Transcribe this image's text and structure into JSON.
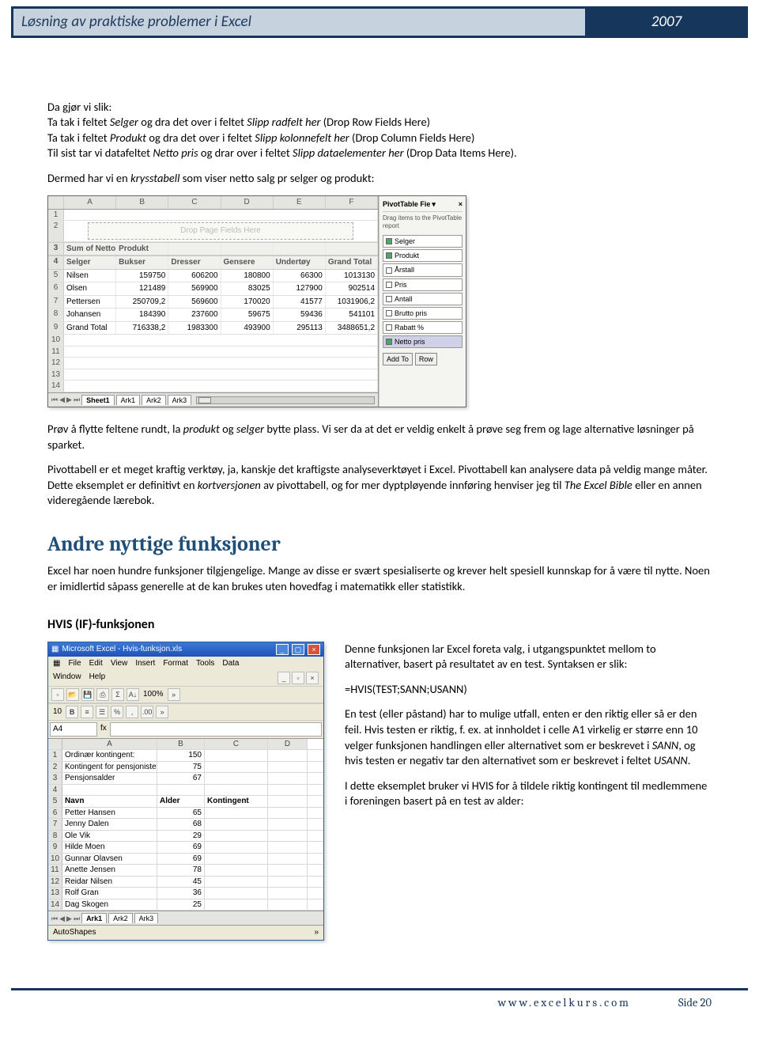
{
  "header": {
    "title": "Løsning av praktiske problemer i Excel",
    "year": "2007"
  },
  "intro": {
    "line1_a": "Da gjør vi slik:",
    "line2_a": "Ta tak i feltet ",
    "line2_b": "Selger",
    "line2_c": " og dra det over i feltet ",
    "line2_d": "Slipp radfelt her",
    "line2_e": " (Drop Row Fields Here)",
    "line3_a": "Ta tak i feltet ",
    "line3_b": "Produkt",
    "line3_c": " og dra det over i feltet ",
    "line3_d": "Slipp kolonnefelt her",
    "line3_e": " (Drop Column Fields Here)",
    "line4_a": "Til sist tar vi datafeltet ",
    "line4_b": "Netto pris",
    "line4_c": " og drar over i feltet ",
    "line4_d": "Slipp dataelementer her",
    "line4_e": " (Drop Data Items Here).",
    "lead2_a": "Dermed har vi en ",
    "lead2_b": "krysstabell",
    "lead2_c": " som viser netto salg pr selger og produkt:"
  },
  "pivot": {
    "cols": [
      "A",
      "B",
      "C",
      "D",
      "E",
      "F"
    ],
    "drop_hint": "Drop Page Fields Here",
    "corner_label": "Sum of Netto pris",
    "col_field": "Produkt",
    "row_field": "Selger",
    "headers": [
      "Bukser",
      "Dresser",
      "Gensere",
      "Undertøy",
      "Grand Total"
    ],
    "rows": [
      {
        "name": "Nilsen",
        "v": [
          "159750",
          "606200",
          "180800",
          "66300",
          "1013130"
        ]
      },
      {
        "name": "Olsen",
        "v": [
          "121489",
          "569900",
          "83025",
          "127900",
          "902514"
        ]
      },
      {
        "name": "Pettersen",
        "v": [
          "250709,2",
          "569600",
          "170020",
          "41577",
          "1031906,2"
        ]
      },
      {
        "name": "Johansen",
        "v": [
          "184390",
          "237600",
          "59675",
          "59436",
          "541101"
        ]
      },
      {
        "name": "Grand Total",
        "v": [
          "716338,2",
          "1983300",
          "493900",
          "295113",
          "3488651,2"
        ]
      }
    ],
    "tabs": [
      "Sheet1",
      "Ark1",
      "Ark2",
      "Ark3"
    ],
    "panel_title": "PivotTable Fie",
    "panel_hint": "Drag items to the PivotTable report",
    "fields": [
      {
        "label": "Selger",
        "checked": true
      },
      {
        "label": "Produkt",
        "checked": true
      },
      {
        "label": "Årstall",
        "checked": false
      },
      {
        "label": "Pris",
        "checked": false
      },
      {
        "label": "Antall",
        "checked": false
      },
      {
        "label": "Brutto pris",
        "checked": false
      },
      {
        "label": "Rabatt %",
        "checked": false
      },
      {
        "label": "Netto pris",
        "checked": true,
        "sel": true
      }
    ],
    "btn_add": "Add To",
    "btn_row": "Row"
  },
  "body": {
    "p1_a": "Prøv å flytte feltene  rundt, la ",
    "p1_b": "produkt",
    "p1_c": " og ",
    "p1_d": "selger",
    "p1_e": " bytte plass. Vi ser da at det er veldig enkelt å prøve seg frem og lage alternative løsninger på sparket.",
    "p2_a": "Pivottabell er et meget kraftig verktøy, ja, kanskje det kraftigste analyseverktøyet i Excel. Pivottabell kan analysere data på veldig mange måter. Dette eksemplet er definitivt en ",
    "p2_b": "kortversjonen",
    "p2_c": " av pivottabell, og for mer dyptpløyende innføring henviser jeg til ",
    "p2_d": "The Excel Bible",
    "p2_e": " eller en annen videregående lærebok."
  },
  "section2": {
    "heading": "Andre nyttige funksjoner",
    "para": "Excel har noen hundre funksjoner tilgjengelige. Mange av disse er svært spesialiserte og krever helt spesiell kunnskap for å være til nytte. Noen er imidlertid såpass generelle at de kan brukes uten hovedfag i matematikk eller statistikk."
  },
  "hvis": {
    "heading": "HVIS (IF)-funksjonen",
    "r1": "Denne funksjonen lar Excel foreta valg, i utgangspunktet mellom to alternativer, basert på resultatet av en test. Syntaksen er slik:",
    "formula": "=HVIS(TEST;SANN;USANN)",
    "r2_a": "En test (eller påstand) har to mulige utfall, enten er den riktig eller så er den feil. Hvis testen er riktig, f. ex. at innholdet i celle A1 virkelig er større enn 10 velger funksjonen handlingen eller alternativet som er beskrevet i ",
    "r2_b": "SANN",
    "r2_c": ", og hvis testen er negativ tar den alternativet som er beskrevet i feltet ",
    "r2_d": "USANN",
    "r2_e": ".",
    "r3": "I dette eksemplet bruker vi HVIS for å tildele riktig kontingent til medlemmene i foreningen basert på en test av alder:"
  },
  "excel2": {
    "title": "Microsoft Excel - Hvis-funksjon.xls",
    "menus": [
      "File",
      "Edit",
      "View",
      "Insert",
      "Format",
      "Tools",
      "Data",
      "Window",
      "Help"
    ],
    "zoom": "100%",
    "fontsize": "10",
    "namebox": "A4",
    "fx_label": "fx",
    "cols": [
      "A",
      "B",
      "C",
      "D"
    ],
    "data_top": [
      {
        "n": "1",
        "a": "Ordinær kontingent:",
        "b": "150",
        "c": "",
        "d": ""
      },
      {
        "n": "2",
        "a": "Kontingent for pensjonister:",
        "b": "75",
        "c": "",
        "d": ""
      },
      {
        "n": "3",
        "a": "Pensjonsalder",
        "b": "67",
        "c": "",
        "d": ""
      },
      {
        "n": "4",
        "a": "",
        "b": "",
        "c": "",
        "d": ""
      }
    ],
    "data_header": {
      "n": "5",
      "a": "Navn",
      "b": "Alder",
      "c": "Kontingent",
      "d": ""
    },
    "data_rows": [
      {
        "n": "6",
        "a": "Petter Hansen",
        "b": "65",
        "c": "",
        "d": ""
      },
      {
        "n": "7",
        "a": "Jenny Dalen",
        "b": "68",
        "c": "",
        "d": ""
      },
      {
        "n": "8",
        "a": "Ole Vik",
        "b": "29",
        "c": "",
        "d": ""
      },
      {
        "n": "9",
        "a": "Hilde Moen",
        "b": "69",
        "c": "",
        "d": ""
      },
      {
        "n": "10",
        "a": "Gunnar Olavsen",
        "b": "69",
        "c": "",
        "d": ""
      },
      {
        "n": "11",
        "a": "Anette Jensen",
        "b": "78",
        "c": "",
        "d": ""
      },
      {
        "n": "12",
        "a": "Reidar Nilsen",
        "b": "45",
        "c": "",
        "d": ""
      },
      {
        "n": "13",
        "a": "Rolf Gran",
        "b": "36",
        "c": "",
        "d": ""
      },
      {
        "n": "14",
        "a": "Dag Skogen",
        "b": "25",
        "c": "",
        "d": ""
      }
    ],
    "tabs": [
      "Ark1",
      "Ark2",
      "Ark3"
    ],
    "autoshapes": "AutoShapes"
  },
  "footer": {
    "url": "www.excelkurs.com",
    "page": "Side 20"
  }
}
